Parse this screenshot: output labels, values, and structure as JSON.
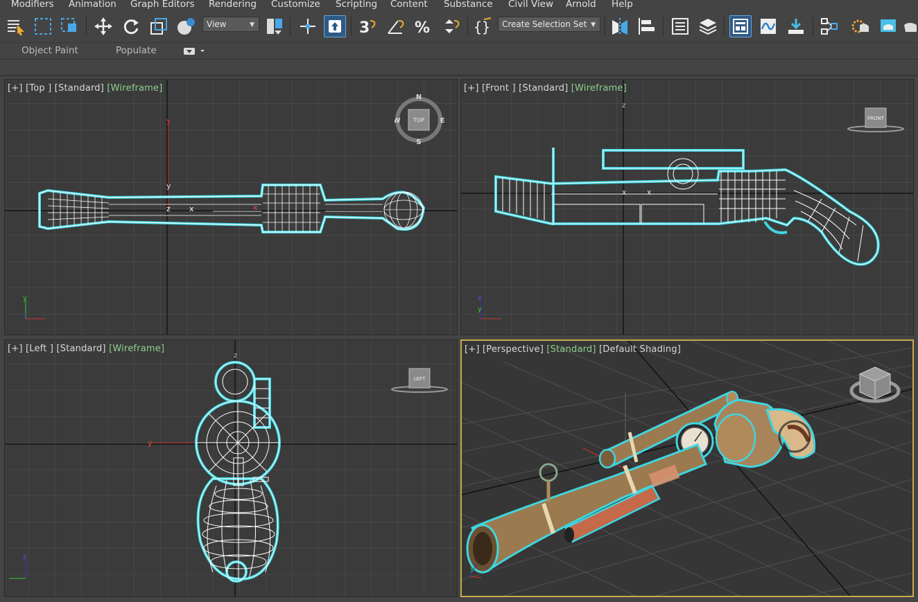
{
  "menu": {
    "items": [
      "Modifiers",
      "Animation",
      "Graph Editors",
      "Rendering",
      "Customize",
      "Scripting",
      "Content",
      "Substance",
      "Civil View",
      "Arnold",
      "Help"
    ]
  },
  "toolbar": {
    "view_dropdown": "View",
    "selection_set_dropdown": "Create Selection Set"
  },
  "ribbon": {
    "tab1": "Object Paint",
    "tab2": "Populate"
  },
  "viewports": {
    "top": {
      "plus": "[+]",
      "name": "[Top ]",
      "shading": "[Standard]",
      "mode": "[Wireframe]"
    },
    "front": {
      "plus": "[+]",
      "name": "[Front ]",
      "shading": "[Standard]",
      "mode": "[Wireframe]"
    },
    "left": {
      "plus": "[+]",
      "name": "[Left ]",
      "shading": "[Standard]",
      "mode": "[Wireframe]"
    },
    "perspective": {
      "plus": "[+]",
      "name": "[Perspective]",
      "shading": "[Standard]",
      "mode": "[Default Shading]"
    }
  },
  "viewcube": {
    "top_face": "TOP",
    "front_face": "FRONT",
    "left_face": "LEFT",
    "compass_n": "N",
    "compass_s": "S",
    "compass_e": "E",
    "compass_w": "W"
  },
  "colors": {
    "background": "#444444",
    "viewport_bg": "#3a3a3a",
    "grid": "#4f4f4f",
    "grid_main": "#151515",
    "wire": "#ffffff",
    "selection_glow": "#3fd6e0",
    "active_border": "#c9a949",
    "brass": "#b08a5a",
    "accent_blue": "#2e5a86"
  }
}
